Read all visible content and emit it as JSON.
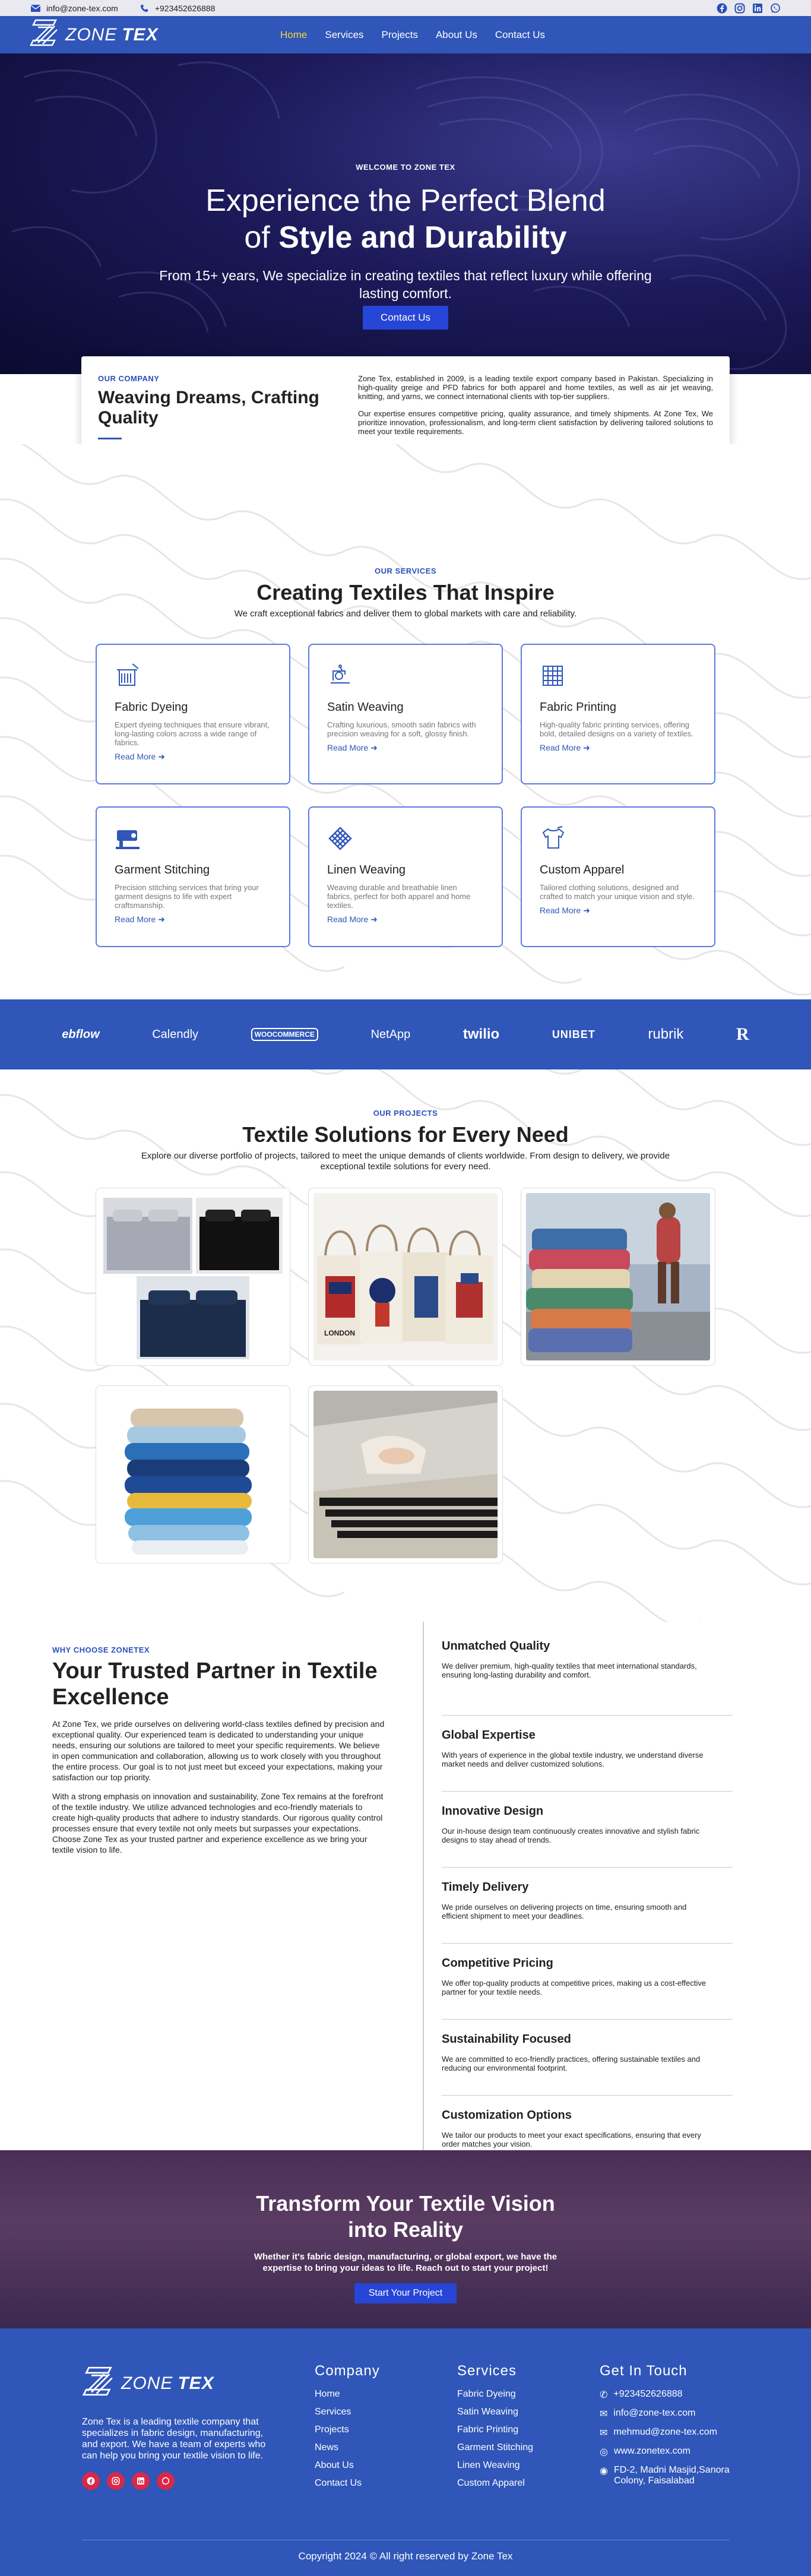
{
  "topbar": {
    "email": "info@zone-tex.com",
    "phone": "+923452626888",
    "socials": [
      "facebook-icon",
      "instagram-icon",
      "linkedin-icon",
      "whatsapp-icon"
    ]
  },
  "nav": {
    "logo_light": "ZONE",
    "logo_bold": "TEX",
    "items": [
      "Home",
      "Services",
      "Projects",
      "About Us",
      "Contact Us"
    ],
    "active": "Home"
  },
  "hero": {
    "kicker": "WELCOME TO ZONE TEX",
    "title_line1": "Experience the Perfect Blend",
    "title_line2_pre": "of",
    "title_line2_bold": "Style and Durability",
    "subtitle": "From 15+ years, We specialize in creating textiles that reflect luxury while offering lasting comfort.",
    "button": "Contact Us"
  },
  "company": {
    "kicker": "OUR COMPANY",
    "title": "Weaving Dreams, Crafting Quality",
    "para1": "Zone Tex, established in 2009, is a leading textile export company based in Pakistan. Specializing in high-quality greige and PFD fabrics for both apparel and home textiles, as well as air jet weaving, knitting, and yarns, we connect international clients with top-tier suppliers.",
    "para2": "Our expertise ensures competitive pricing, quality assurance, and timely shipments. At Zone Tex, We prioritize innovation, professionalism, and long-term client satisfaction by delivering tailored solutions to meet your textile requirements."
  },
  "services": {
    "kicker": "OUR SERVICES",
    "title": "Creating Textiles That Inspire",
    "subtitle": "We craft exceptional fabrics and deliver them to global markets with care and reliability.",
    "read_more": "Read More",
    "items": [
      {
        "title": "Fabric Dyeing",
        "desc": "Expert dyeing techniques that ensure vibrant, long-lasting colors across a wide range of fabrics."
      },
      {
        "title": "Satin Weaving",
        "desc": "Crafting luxurious, smooth satin fabrics with precision weaving for a soft, glossy finish."
      },
      {
        "title": "Fabric Printing",
        "desc": "High-quality fabric printing services, offering bold, detailed designs on a variety of textiles."
      },
      {
        "title": "Garment Stitching",
        "desc": "Precision stitching services that bring your garment designs to life with expert craftsmanship."
      },
      {
        "title": "Linen Weaving",
        "desc": "Weaving durable and breathable linen fabrics, perfect for both apparel and home textiles."
      },
      {
        "title": "Custom Apparel",
        "desc": "Tailored clothing solutions, designed and crafted to match your unique vision and style."
      }
    ]
  },
  "brands": [
    "ebflow",
    "Calendly",
    "WOOCOMMERCE",
    "NetApp",
    "twilio",
    "UNIBET",
    "rubrik",
    "R"
  ],
  "projects": {
    "kicker": "OUR PROJECTS",
    "title": "Textile Solutions for Every Need",
    "subtitle": "Explore our diverse portfolio of projects, tailored to meet the unique demands of clients worldwide. From design to delivery, we provide exceptional textile solutions for every need."
  },
  "why": {
    "kicker": "WHY CHOOSE ZONETEX",
    "title": "Your Trusted Partner in Textile Excellence",
    "para1": "At Zone Tex, we pride ourselves on delivering world-class textiles defined by precision and exceptional quality. Our experienced team is dedicated to understanding your unique needs, ensuring our solutions are tailored to meet your specific requirements. We believe in open communication and collaboration, allowing us to work closely with you throughout the entire process. Our goal is to not just meet but exceed your expectations, making your satisfaction our top priority.",
    "para2": "With a strong emphasis on innovation and sustainability, Zone Tex remains at the forefront of the textile industry. We utilize advanced technologies and eco-friendly materials to create high-quality products that adhere to industry standards. Our rigorous quality control processes ensure that every textile not only meets but surpasses your expectations. Choose Zone Tex as your trusted partner and experience excellence as we bring your textile vision to life.",
    "features": [
      {
        "title": "Unmatched Quality",
        "desc": "We deliver premium, high-quality textiles that meet international standards, ensuring long-lasting durability and comfort."
      },
      {
        "title": "Global Expertise",
        "desc": "With years of experience in the global textile industry, we understand diverse market needs and deliver customized solutions."
      },
      {
        "title": "Innovative Design",
        "desc": "Our in-house design team continuously creates innovative and stylish fabric designs to stay ahead of trends."
      },
      {
        "title": "Timely Delivery",
        "desc": "We pride ourselves on delivering projects on time, ensuring smooth and efficient shipment to meet your deadlines."
      },
      {
        "title": "Competitive Pricing",
        "desc": "We offer top-quality products at competitive prices, making us a cost-effective partner for your textile needs."
      },
      {
        "title": "Sustainability Focused",
        "desc": "We are committed to eco-friendly practices, offering sustainable textiles and reducing our environmental footprint."
      },
      {
        "title": "Customization Options",
        "desc": "We tailor our products to meet your exact specifications, ensuring that every order matches your vision."
      }
    ]
  },
  "cta": {
    "title": "Transform Your Textile Vision into Reality",
    "subtitle": "Whether it's fabric design, manufacturing, or global export, we have the expertise to bring your ideas to life. Reach out to start your project!",
    "button": "Start Your Project"
  },
  "footer": {
    "about": "Zone Tex is a leading textile company that specializes in fabric design, manufacturing, and export. We have a team of experts who can help you bring your textile vision to life.",
    "company_title": "Company",
    "company_links": [
      "Home",
      "Services",
      "Projects",
      "News",
      "About Us",
      "Contact Us"
    ],
    "services_title": "Services",
    "services_links": [
      "Fabric Dyeing",
      "Satin Weaving",
      "Fabric Printing",
      "Garment Stitching",
      "Linen Weaving",
      "Custom Apparel"
    ],
    "contact_title": "Get In Touch",
    "contact": [
      "+923452626888",
      "info@zone-tex.com",
      "mehmud@zone-tex.com",
      "www.zonetex.com",
      "FD-2, Madni Masjid,Sanora Colony, Faisalabad"
    ],
    "copyright": "Copyright 2024 © All right reserved by Zone Tex"
  },
  "colors": {
    "brand": "#2f56b8",
    "accent": "#2745d6",
    "active_nav": "#ffd33b",
    "social": "#d92848"
  }
}
